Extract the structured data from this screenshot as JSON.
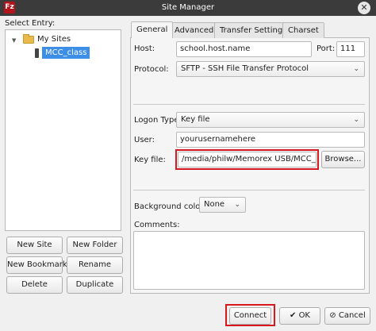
{
  "window": {
    "title": "Site Manager",
    "app_icon": "Fz",
    "close_glyph": "✕"
  },
  "tree": {
    "section_label": "Select Entry:",
    "expand_glyph": "▼",
    "folder_label": "My Sites",
    "selected_site": "MCC_class"
  },
  "left_buttons": {
    "new_site": "New Site",
    "new_folder": "New Folder",
    "new_bookmark": "New Bookmark",
    "rename": "Rename",
    "delete": "Delete",
    "duplicate": "Duplicate"
  },
  "tabs": [
    "General",
    "Advanced",
    "Transfer Settings",
    "Charset"
  ],
  "general": {
    "host_label": "Host:",
    "host_value": "school.host.name",
    "port_label": "Port:",
    "port_value": "111",
    "protocol_label": "Protocol:",
    "protocol_value": "SFTP - SSH File Transfer Protocol",
    "logon_label": "Logon Type:",
    "logon_value": "Key file",
    "user_label": "User:",
    "user_value": "yourusernamehere",
    "keyfile_label": "Key file:",
    "keyfile_value": "/media/philw/Memorex USB/MCC_Classes",
    "browse_label": "Browse...",
    "bg_color_label": "Background color:",
    "bg_color_value": "None",
    "comments_label": "Comments:",
    "comments_value": ""
  },
  "footer": {
    "connect": "Connect",
    "ok": "OK",
    "cancel": "Cancel",
    "ok_icon": "✔",
    "cancel_icon": "⊘"
  },
  "chevron_glyph": "⌄",
  "colors": {
    "highlight_red": "#d7191f",
    "selection_blue": "#3d8ee6",
    "titlebar": "#3b3b3b"
  }
}
